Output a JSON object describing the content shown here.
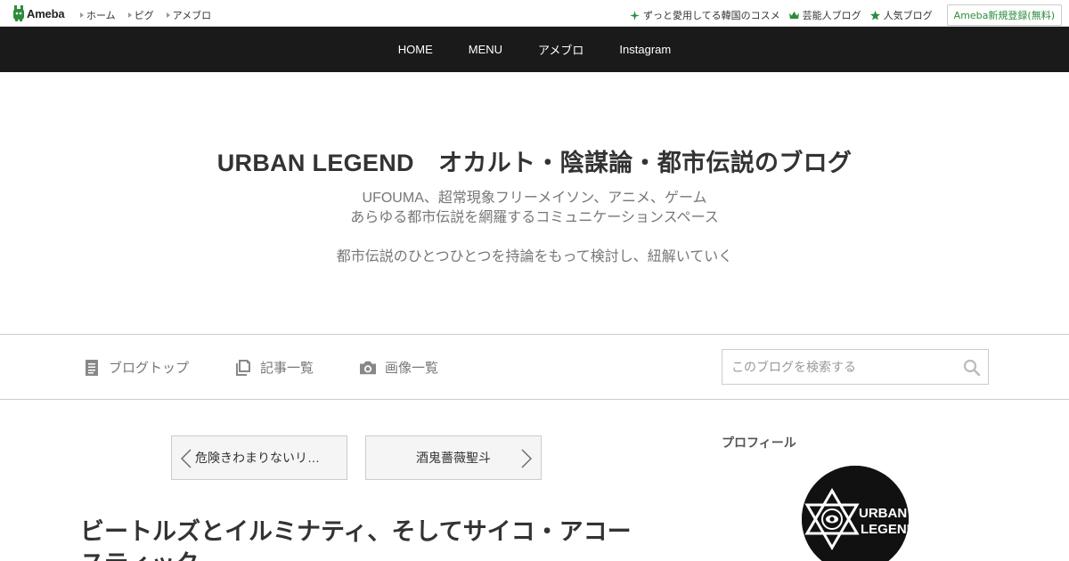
{
  "global_header": {
    "logo_text": "Ameba",
    "nav": [
      "ホーム",
      "ピグ",
      "アメブロ"
    ],
    "right_links": [
      {
        "icon": "sparkle-icon",
        "label": "ずっと愛用してる韓国のコスメ"
      },
      {
        "icon": "crown-icon",
        "label": "芸能人ブログ"
      },
      {
        "icon": "star-icon",
        "label": "人気ブログ"
      }
    ],
    "register_label": "Ameba新規登録(無料)",
    "accent_color": "#2d8c3c"
  },
  "blog_nav": [
    "HOME",
    "MENU",
    "アメブロ",
    "Instagram"
  ],
  "blog_header": {
    "title": "URBAN LEGEND　オカルト・陰謀論・都市伝説のブログ",
    "desc_line1": "UFOUMA、超常現象フリーメイソン、アニメ、ゲーム",
    "desc_line2": "あらゆる都市伝説を網羅するコミュニケーションスペース",
    "desc_line3": "都市伝説のひとつひとつを持論をもって検討し、紐解いていく"
  },
  "sub_nav": {
    "items": [
      {
        "icon": "document-icon",
        "label": "ブログトップ"
      },
      {
        "icon": "copy-icon",
        "label": "記事一覧"
      },
      {
        "icon": "camera-icon",
        "label": "画像一覧"
      }
    ],
    "search_placeholder": "このブログを検索する"
  },
  "pager": {
    "prev_label": "危険きわまりないリ…",
    "next_label": "酒鬼薔薇聖斗"
  },
  "entry": {
    "title": "ビートルズとイルミナティ、そしてサイコ・アコースティック"
  },
  "sidebar": {
    "profile_heading": "プロフィール",
    "avatar_text_line1": "URBAN",
    "avatar_text_line2": "LEGEND"
  }
}
